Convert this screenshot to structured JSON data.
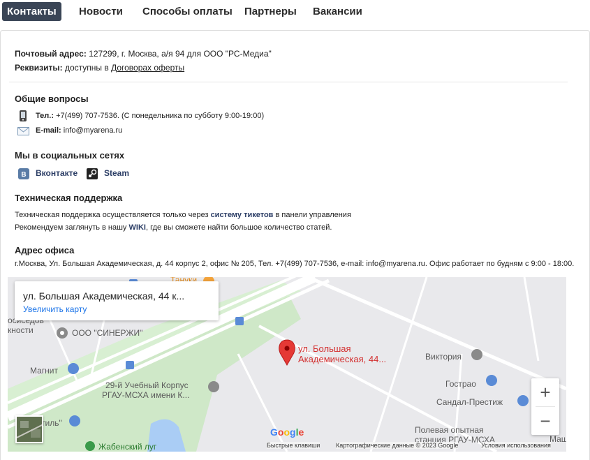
{
  "tabs": [
    {
      "label": "Контакты"
    },
    {
      "label": "Новости"
    },
    {
      "label": "Способы оплаты"
    },
    {
      "label": "Партнеры"
    },
    {
      "label": "Вакансии"
    }
  ],
  "postal": {
    "label": "Почтовый адрес:",
    "value": "127299, г. Москва, а/я 94 для ООО \"РС-Медиа\""
  },
  "requisites": {
    "label": "Реквизиты:",
    "value": "доступны в ",
    "link": "Договорах оферты"
  },
  "general": {
    "heading": "Общие вопросы",
    "phone_label": "Тел.:",
    "phone_value": "+7(499) 707-7536. (С понедельника по субботу 9:00-19:00)",
    "email_label": "E-mail:",
    "email_value": "info@myarena.ru"
  },
  "social": {
    "heading": "Мы в социальных сетях",
    "vk": "Вконтакте",
    "steam": "Steam"
  },
  "support": {
    "heading": "Техническая поддержка",
    "line1_pre": "Техническая поддержка осуществляется только через ",
    "line1_link": "систему тикетов",
    "line1_post": " в панели управления",
    "line2_pre": "Рекомендуем заглянуть в нашу ",
    "line2_link": "WIKI",
    "line2_post": ", где вы сможете найти большое количество статей."
  },
  "office": {
    "heading": "Адрес офиса",
    "text": "г.Москва, Ул. Большая Академическая, д. 44 корпус 2, офис № 205, Тел. +7(499) 707-7536, e-mail: info@myarena.ru. Офис работает по будням с 9:00 - 18:00."
  },
  "map": {
    "card_title": "ул. Большая Академическая, 44 к...",
    "card_link": "Увеличить карту",
    "marker_label_1": "ул. Большая",
    "marker_label_2": "Академическая, 44...",
    "places": {
      "tanuki": "Тануки",
      "sinergy": "ООО \"СИНЕРЖИ\"",
      "magnit": "Магнит",
      "korpus1": "29-й Учебный Корпус",
      "korpus2": "РГАУ-МСХА имени К...",
      "viktoriya": "Виктория",
      "gostrao": "Гострао",
      "sandal": "Сандал-Престиж",
      "polevaya1": "Полевая опытная",
      "polevaya2": "станция РГАУ-МСХА",
      "zhab": "Жабенский луг",
      "left1": "осиседов",
      "left2": "кности",
      "left3": "тиль\"",
      "mash": "Маши"
    },
    "zoom_in": "+",
    "zoom_out": "−",
    "google": "Google",
    "footer_keys": "Быстрые клавиши",
    "footer_data": "Картографические данные © 2023 Google",
    "footer_terms": "Условия использования",
    "colors": {
      "road": "#ffffff",
      "park": "#c9e9c3",
      "water": "#aacdf5",
      "marker": "#e53935"
    }
  }
}
